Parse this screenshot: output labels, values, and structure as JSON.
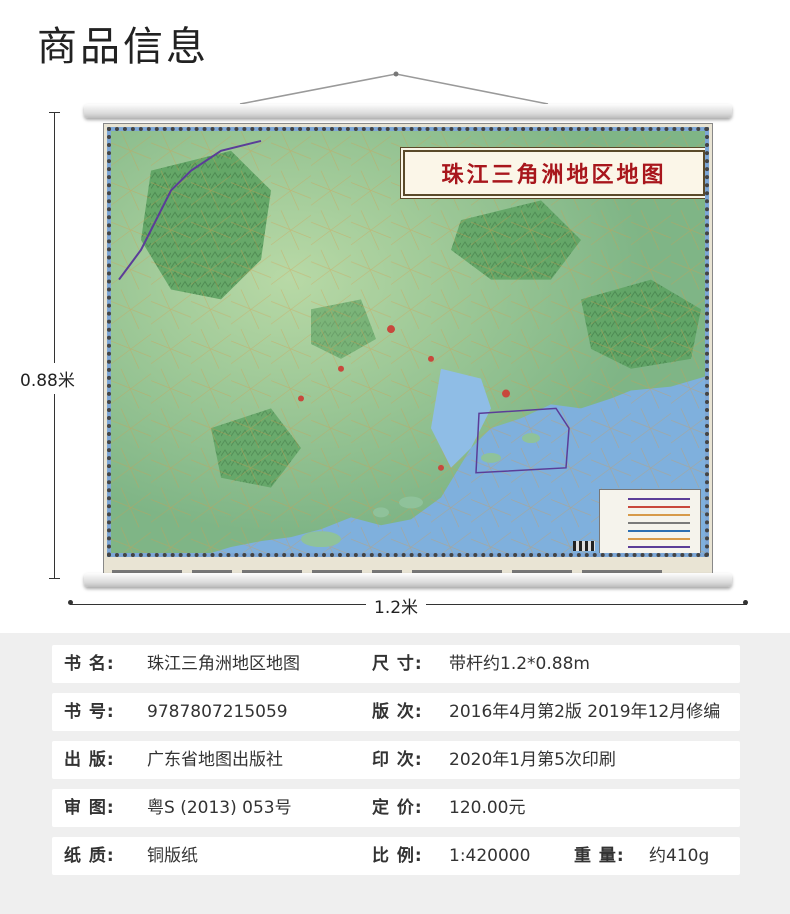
{
  "page": {
    "title": "商品信息"
  },
  "map": {
    "title": "珠江三角洲地区地图",
    "height_label": "0.88米",
    "width_label": "1.2米"
  },
  "info": {
    "title_k": "书 名:",
    "title_v": "珠江三角洲地区地图",
    "size_k": "尺 寸:",
    "size_v": "带杆约1.2*0.88m",
    "isbn_k": "书 号:",
    "isbn_v": "9787807215059",
    "edition_k": "版 次:",
    "edition_v": "2016年4月第2版 2019年12月修编",
    "publisher_k": "出 版:",
    "publisher_v": "广东省地图出版社",
    "print_k": "印 次:",
    "print_v": "2020年1月第5次印刷",
    "review_k": "审 图:",
    "review_v": "粤S (2013) 053号",
    "price_k": "定 价:",
    "price_v": "120.00元",
    "paper_k": "纸 质:",
    "paper_v": "铜版纸",
    "scale_k": "比 例:",
    "scale_v": "1:420000",
    "weight_k": "重 量:",
    "weight_v": "约410g"
  },
  "colors": {
    "sea": "#7da7d6",
    "land": "#8fc29a",
    "mountain": "#4f9a55",
    "title_red": "#a8161c",
    "panel_bg": "#efefef"
  }
}
